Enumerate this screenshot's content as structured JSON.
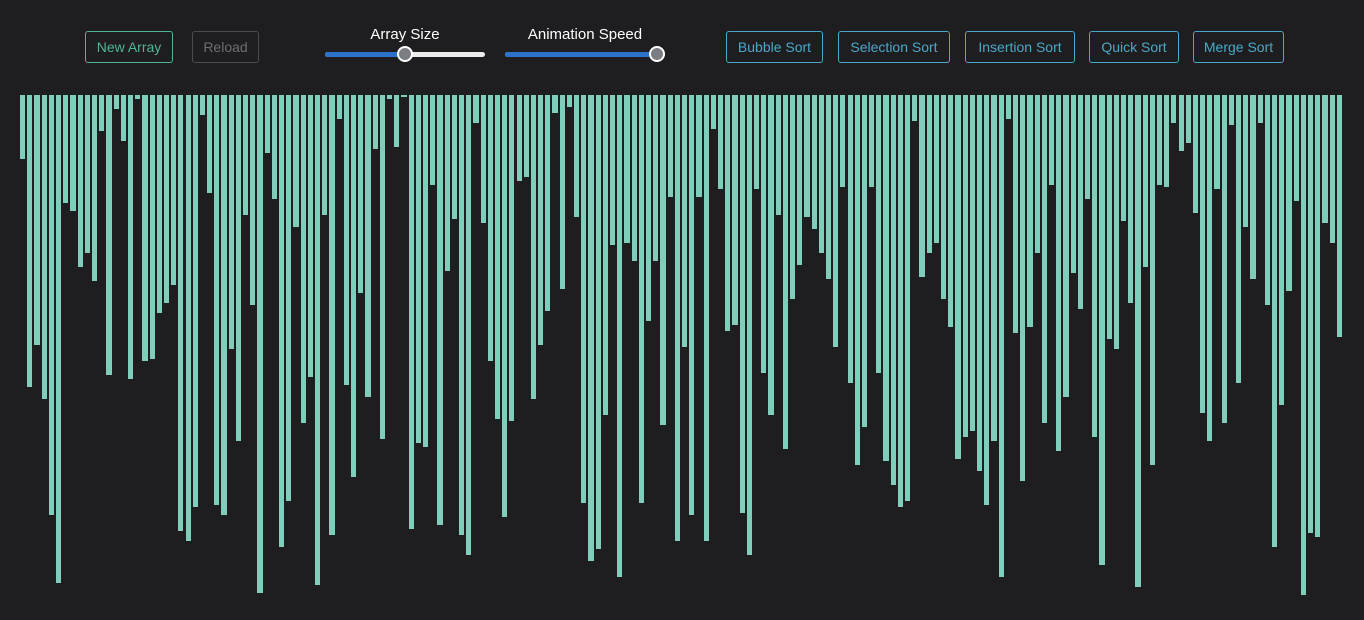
{
  "toolbar": {
    "new_array_label": "New Array",
    "reload_label": "Reload",
    "array_size_label": "Array Size",
    "animation_speed_label": "Animation Speed",
    "array_size_value": 0.5,
    "animation_speed_value": 1.0,
    "sort_buttons": [
      "Bubble Sort",
      "Selection Sort",
      "Insertion Sort",
      "Quick Sort",
      "Merge Sort"
    ]
  },
  "colors": {
    "background": "#1e1e20",
    "bar": "#7ecebb",
    "green_button": "#50b39a",
    "blue_button": "#4aa8c9",
    "slider_fill": "#2d72cc"
  },
  "array": {
    "values": [
      64,
      292,
      250,
      304,
      420,
      488,
      108,
      116,
      172,
      158,
      186,
      36,
      280,
      14,
      46,
      284,
      4,
      266,
      264,
      218,
      208,
      190,
      436,
      446,
      412,
      20,
      98,
      410,
      420,
      254,
      346,
      120,
      210,
      498,
      58,
      104,
      452,
      406,
      132,
      328,
      282,
      490,
      120,
      440,
      24,
      290,
      382,
      198,
      302,
      54,
      344,
      4,
      52,
      2,
      434,
      348,
      352,
      90,
      430,
      176,
      124,
      440,
      460,
      28,
      128,
      266,
      324,
      422,
      326,
      86,
      82,
      304,
      250,
      216,
      18,
      194,
      12,
      122,
      408,
      466,
      454,
      320,
      150,
      482,
      148,
      166,
      408,
      226,
      166,
      330,
      102,
      446,
      252,
      420,
      102,
      446,
      34,
      94,
      236,
      230,
      418,
      460,
      94,
      278,
      320,
      120,
      354,
      204,
      170,
      122,
      134,
      158,
      184,
      252,
      92,
      288,
      370,
      332,
      92,
      278,
      366,
      390,
      412,
      406,
      26,
      182,
      158,
      148,
      204,
      232,
      364,
      342,
      336,
      376,
      410,
      346,
      482,
      24,
      238,
      386,
      232,
      158,
      328,
      90,
      356,
      302,
      178,
      214,
      104,
      342,
      470,
      244,
      254,
      126,
      208,
      492,
      172,
      370,
      90,
      92,
      28,
      56,
      48,
      118,
      318,
      346,
      94,
      328,
      30,
      288,
      132,
      184,
      28,
      210,
      452,
      310,
      196,
      106,
      500,
      438,
      442,
      128,
      148,
      242
    ]
  }
}
